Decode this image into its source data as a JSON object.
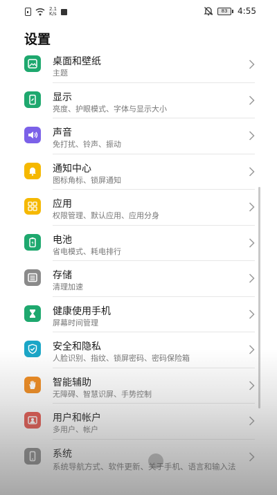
{
  "status_bar": {
    "net_speed_value": "2.1",
    "net_speed_unit": "K/s",
    "battery": "83",
    "time": "4:55"
  },
  "page_title": "设置",
  "settings": [
    {
      "title": "桌面和壁纸",
      "subtitle": "主题",
      "icon": "wallpaper-icon",
      "color": "#1ea86e"
    },
    {
      "title": "显示",
      "subtitle": "亮度、护眼模式、字体与显示大小",
      "icon": "display-icon",
      "color": "#1ea86e"
    },
    {
      "title": "声音",
      "subtitle": "免打扰、铃声、振动",
      "icon": "speaker-icon",
      "color": "#7b61e8"
    },
    {
      "title": "通知中心",
      "subtitle": "图标角标、锁屏通知",
      "icon": "bell-icon",
      "color": "#f5b800"
    },
    {
      "title": "应用",
      "subtitle": "权限管理、默认应用、应用分身",
      "icon": "apps-grid-icon",
      "color": "#f5b800"
    },
    {
      "title": "电池",
      "subtitle": "省电模式、耗电排行",
      "icon": "battery-icon",
      "color": "#1ea86e"
    },
    {
      "title": "存储",
      "subtitle": "清理加速",
      "icon": "storage-icon",
      "color": "#8a8a8a"
    },
    {
      "title": "健康使用手机",
      "subtitle": "屏幕时间管理",
      "icon": "hourglass-icon",
      "color": "#1ea86e"
    },
    {
      "title": "安全和隐私",
      "subtitle": "人脸识别、指纹、锁屏密码、密码保险箱",
      "icon": "shield-icon",
      "color": "#1aa6c7"
    },
    {
      "title": "智能辅助",
      "subtitle": "无障碍、智慧识屏、手势控制",
      "icon": "hand-icon",
      "color": "#f08a1c"
    },
    {
      "title": "用户和帐户",
      "subtitle": "多用户、帐户",
      "icon": "user-icon",
      "color": "#e4534a"
    },
    {
      "title": "系统",
      "subtitle": "系统导航方式、软件更新、关于手机、语言和输入法",
      "icon": "phone-icon",
      "color": "#8a8a8a"
    }
  ]
}
